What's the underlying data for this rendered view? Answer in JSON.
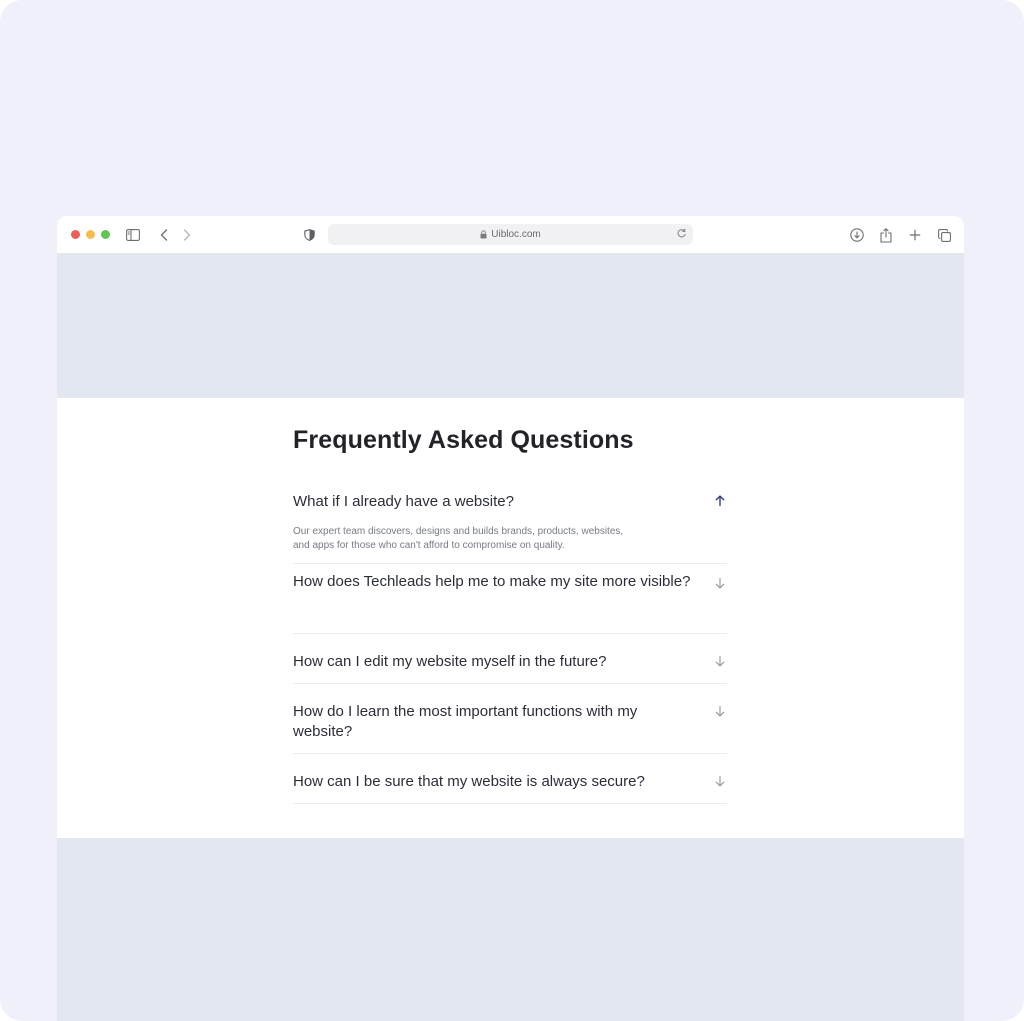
{
  "browser": {
    "url": "Uibloc.com",
    "icons": {
      "sidebar": "sidebar-icon",
      "back": "chevron-left-icon",
      "forward": "chevron-right-icon",
      "shield": "shield-icon",
      "lock": "lock-icon",
      "reload": "reload-icon",
      "download": "download-icon",
      "share": "share-icon",
      "new_tab": "plus-icon",
      "tabs": "tabs-icon"
    }
  },
  "faq": {
    "title": "Frequently Asked Questions",
    "items": [
      {
        "question": "What if I already have a website?",
        "answer": "Our expert team discovers, designs and builds brands, products, websites, and apps for those who can't afford to compromise on quality.",
        "expanded": true,
        "icon": "arrow-up-icon"
      },
      {
        "question": "How does Techleads help me to make my site more visible?",
        "expanded": false,
        "icon": "arrow-down-icon"
      },
      {
        "question": "How can I edit my website myself in the future?",
        "expanded": false,
        "icon": "arrow-down-icon"
      },
      {
        "question": "How do I learn the most important functions with my website?",
        "expanded": false,
        "icon": "arrow-down-icon"
      },
      {
        "question": "How can I be sure that my website is always secure?",
        "expanded": false,
        "icon": "arrow-down-icon"
      }
    ]
  },
  "colors": {
    "page_background": "#f0f0fb",
    "content_background": "#e3e8f0",
    "active_icon": "#3a3a8c",
    "inactive_icon": "#9a9ca6"
  }
}
